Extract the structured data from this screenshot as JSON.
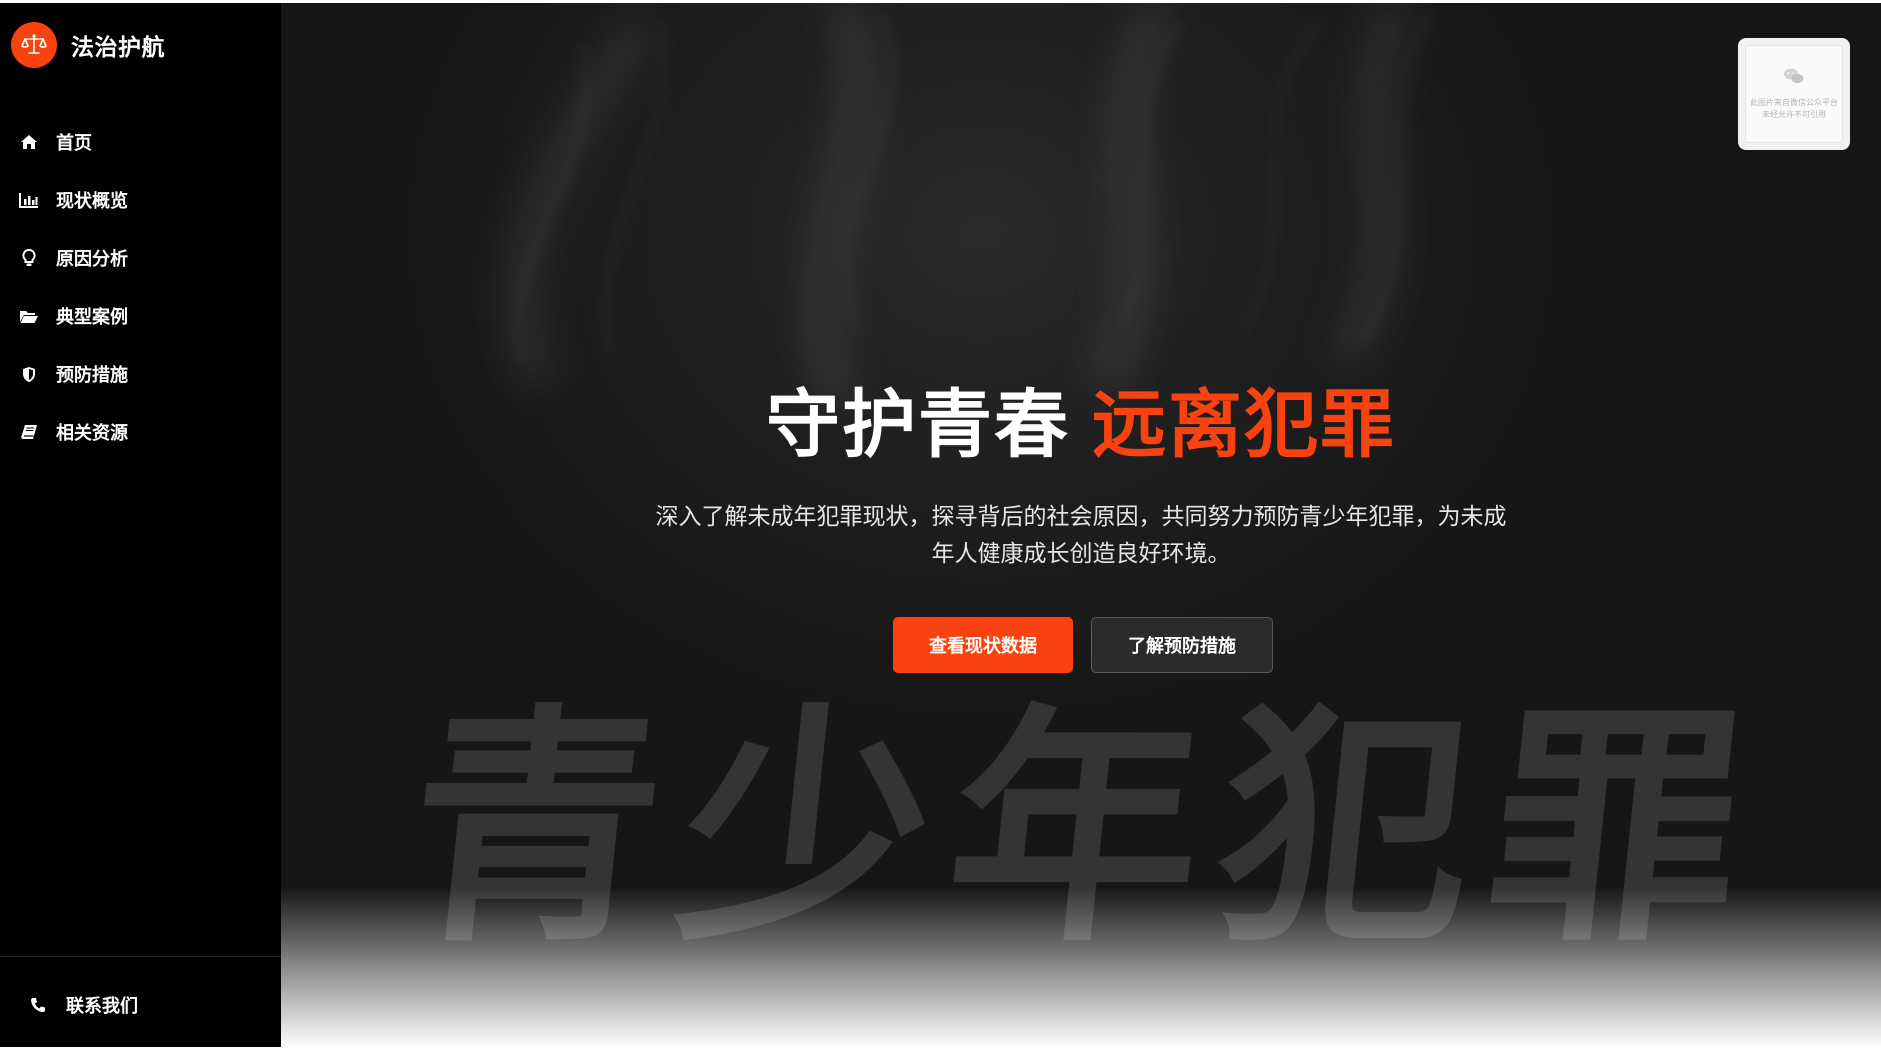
{
  "brand": {
    "name": "法治护航",
    "logo_icon": "scale-icon",
    "accent_color": "#f8420f"
  },
  "nav": {
    "items": [
      {
        "label": "首页",
        "icon": "home-icon"
      },
      {
        "label": "现状概览",
        "icon": "bar-chart-icon"
      },
      {
        "label": "原因分析",
        "icon": "lightbulb-icon"
      },
      {
        "label": "典型案例",
        "icon": "folder-open-icon"
      },
      {
        "label": "预防措施",
        "icon": "shield-icon"
      },
      {
        "label": "相关资源",
        "icon": "book-icon"
      }
    ],
    "contact": {
      "label": "联系我们",
      "icon": "phone-icon"
    }
  },
  "hero": {
    "headline_white": "守护青春",
    "headline_accent": "远离犯罪",
    "subtitle": "深入了解未成年犯罪现状，探寻背后的社会原因，共同努力预防青少年犯罪，为未成年人健康成长创造良好环境。",
    "primary_button": "查看现状数据",
    "secondary_button": "了解预防措施",
    "background_watermark": "青少年犯罪"
  },
  "qr": {
    "notice": "此图片来自微信公众平台未经允许不可引用",
    "icon": "wechat-icon"
  }
}
